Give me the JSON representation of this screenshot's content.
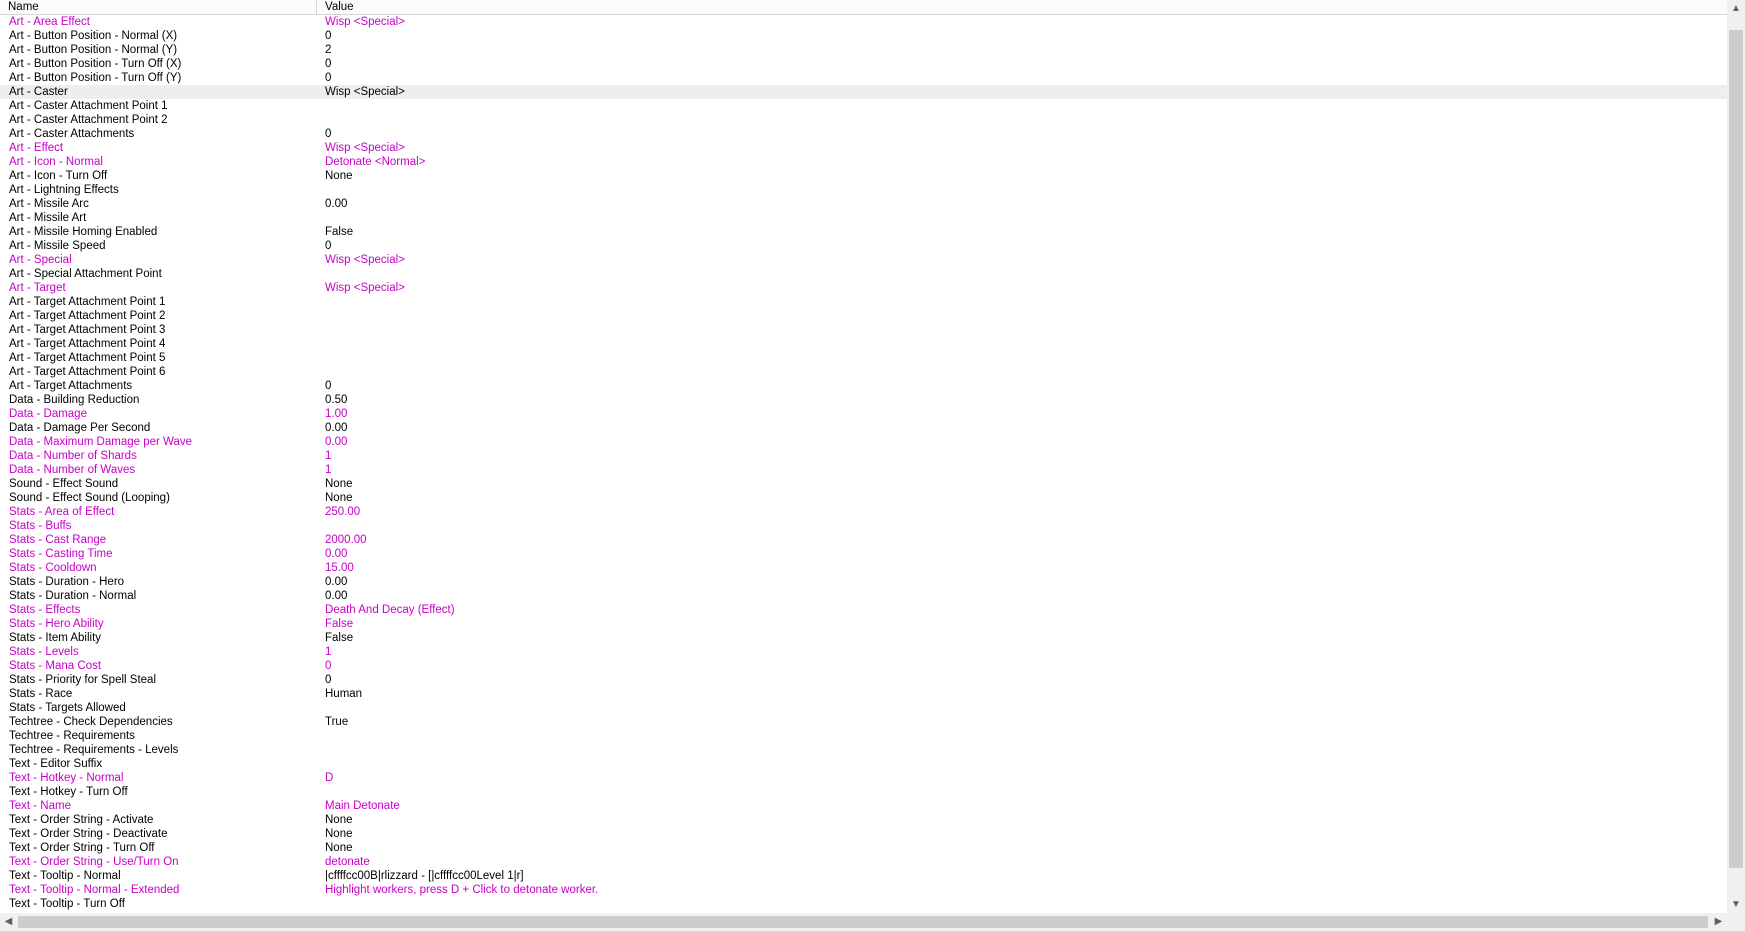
{
  "header": {
    "name": "Name",
    "value": "Value"
  },
  "colors": {
    "modified": "#c800c8",
    "default": "#000000",
    "selected_row": "#eeeeee"
  },
  "rows": [
    {
      "name": "Art - Area Effect",
      "value": "Wisp <Special>",
      "modified": true
    },
    {
      "name": "Art - Button Position - Normal (X)",
      "value": "0",
      "modified": false
    },
    {
      "name": "Art - Button Position - Normal (Y)",
      "value": "2",
      "modified": false
    },
    {
      "name": "Art - Button Position - Turn Off (X)",
      "value": "0",
      "modified": false
    },
    {
      "name": "Art - Button Position - Turn Off (Y)",
      "value": "0",
      "modified": false
    },
    {
      "name": "Art - Caster",
      "value": "Wisp <Special>",
      "modified": false,
      "selected": true
    },
    {
      "name": "Art - Caster Attachment Point 1",
      "value": "",
      "modified": false
    },
    {
      "name": "Art - Caster Attachment Point 2",
      "value": "",
      "modified": false
    },
    {
      "name": "Art - Caster Attachments",
      "value": "0",
      "modified": false
    },
    {
      "name": "Art - Effect",
      "value": "Wisp <Special>",
      "modified": true
    },
    {
      "name": "Art - Icon - Normal",
      "value": "Detonate <Normal>",
      "modified": true
    },
    {
      "name": "Art - Icon - Turn Off",
      "value": "None",
      "modified": false
    },
    {
      "name": "Art - Lightning Effects",
      "value": "",
      "modified": false
    },
    {
      "name": "Art - Missile Arc",
      "value": "0.00",
      "modified": false
    },
    {
      "name": "Art - Missile Art",
      "value": "",
      "modified": false
    },
    {
      "name": "Art - Missile Homing Enabled",
      "value": "False",
      "modified": false
    },
    {
      "name": "Art - Missile Speed",
      "value": "0",
      "modified": false
    },
    {
      "name": "Art - Special",
      "value": "Wisp <Special>",
      "modified": true
    },
    {
      "name": "Art - Special Attachment Point",
      "value": "",
      "modified": false
    },
    {
      "name": "Art - Target",
      "value": "Wisp <Special>",
      "modified": true
    },
    {
      "name": "Art - Target Attachment Point 1",
      "value": "",
      "modified": false
    },
    {
      "name": "Art - Target Attachment Point 2",
      "value": "",
      "modified": false
    },
    {
      "name": "Art - Target Attachment Point 3",
      "value": "",
      "modified": false
    },
    {
      "name": "Art - Target Attachment Point 4",
      "value": "",
      "modified": false
    },
    {
      "name": "Art - Target Attachment Point 5",
      "value": "",
      "modified": false
    },
    {
      "name": "Art - Target Attachment Point 6",
      "value": "",
      "modified": false
    },
    {
      "name": "Art - Target Attachments",
      "value": "0",
      "modified": false
    },
    {
      "name": "Data - Building Reduction",
      "value": "0.50",
      "modified": false
    },
    {
      "name": "Data - Damage",
      "value": "1.00",
      "modified": true
    },
    {
      "name": "Data - Damage Per Second",
      "value": "0.00",
      "modified": false
    },
    {
      "name": "Data - Maximum Damage per Wave",
      "value": "0.00",
      "modified": true
    },
    {
      "name": "Data - Number of Shards",
      "value": "1",
      "modified": true
    },
    {
      "name": "Data - Number of Waves",
      "value": "1",
      "modified": true
    },
    {
      "name": "Sound - Effect Sound",
      "value": "None",
      "modified": false
    },
    {
      "name": "Sound - Effect Sound (Looping)",
      "value": "None",
      "modified": false
    },
    {
      "name": "Stats - Area of Effect",
      "value": "250.00",
      "modified": true
    },
    {
      "name": "Stats - Buffs",
      "value": "",
      "modified": true
    },
    {
      "name": "Stats - Cast Range",
      "value": "2000.00",
      "modified": true
    },
    {
      "name": "Stats - Casting Time",
      "value": "0.00",
      "modified": true
    },
    {
      "name": "Stats - Cooldown",
      "value": "15.00",
      "modified": true
    },
    {
      "name": "Stats - Duration - Hero",
      "value": "0.00",
      "modified": false
    },
    {
      "name": "Stats - Duration - Normal",
      "value": "0.00",
      "modified": false
    },
    {
      "name": "Stats - Effects",
      "value": "Death And Decay (Effect)",
      "modified": true
    },
    {
      "name": "Stats - Hero Ability",
      "value": "False",
      "modified": true
    },
    {
      "name": "Stats - Item Ability",
      "value": "False",
      "modified": false
    },
    {
      "name": "Stats - Levels",
      "value": "1",
      "modified": true
    },
    {
      "name": "Stats - Mana Cost",
      "value": "0",
      "modified": true
    },
    {
      "name": "Stats - Priority for Spell Steal",
      "value": "0",
      "modified": false
    },
    {
      "name": "Stats - Race",
      "value": "Human",
      "modified": false
    },
    {
      "name": "Stats - Targets Allowed",
      "value": "",
      "modified": false
    },
    {
      "name": "Techtree - Check Dependencies",
      "value": "True",
      "modified": false
    },
    {
      "name": "Techtree - Requirements",
      "value": "",
      "modified": false
    },
    {
      "name": "Techtree - Requirements - Levels",
      "value": "",
      "modified": false
    },
    {
      "name": "Text - Editor Suffix",
      "value": "",
      "modified": false
    },
    {
      "name": "Text - Hotkey - Normal",
      "value": "D",
      "modified": true
    },
    {
      "name": "Text - Hotkey - Turn Off",
      "value": "",
      "modified": false
    },
    {
      "name": "Text - Name",
      "value": "Main Detonate",
      "modified": true
    },
    {
      "name": "Text - Order String - Activate",
      "value": "None",
      "modified": false
    },
    {
      "name": "Text - Order String - Deactivate",
      "value": "None",
      "modified": false
    },
    {
      "name": "Text - Order String - Turn Off",
      "value": "None",
      "modified": false
    },
    {
      "name": "Text - Order String - Use/Turn On",
      "value": "detonate",
      "modified": true
    },
    {
      "name": "Text - Tooltip - Normal",
      "value": "|cffffcc00B|rlizzard - [|cffffcc00Level 1|r]",
      "modified": false
    },
    {
      "name": "Text - Tooltip - Normal - Extended",
      "value": "Highlight workers, press D + Click to detonate worker.",
      "modified": true
    },
    {
      "name": "Text - Tooltip - Turn Off",
      "value": "",
      "modified": false
    }
  ]
}
